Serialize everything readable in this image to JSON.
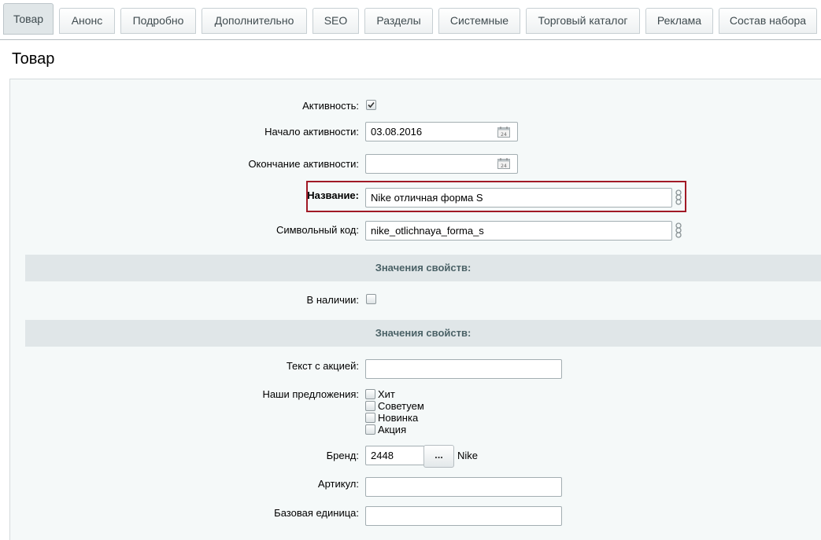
{
  "tabs": [
    "Товар",
    "Анонс",
    "Подробно",
    "Дополнительно",
    "SEO",
    "Разделы",
    "Системные",
    "Торговый каталог",
    "Реклама",
    "Состав набора"
  ],
  "page_title": "Товар",
  "fields": {
    "active": {
      "label": "Активность:",
      "checked": true
    },
    "start": {
      "label": "Начало активности:",
      "value": "03.08.2016"
    },
    "end": {
      "label": "Окончание активности:",
      "value": ""
    },
    "name": {
      "label": "Название:",
      "value": "Nike отличная форма S"
    },
    "code": {
      "label": "Символьный код:",
      "value": "nike_otlichnaya_forma_s"
    }
  },
  "section1": "Значения свойств:",
  "in_stock": {
    "label": "В наличии:",
    "checked": false
  },
  "section2": "Значения свойств:",
  "promo_text": {
    "label": "Текст с акцией:",
    "value": ""
  },
  "offers": {
    "label": "Наши предложения:",
    "options": [
      "Хит",
      "Советуем",
      "Новинка",
      "Акция"
    ]
  },
  "brand": {
    "label": "Бренд:",
    "value": "2448",
    "button": "...",
    "name": "Nike"
  },
  "article": {
    "label": "Артикул:",
    "value": ""
  },
  "base_unit": {
    "label": "Базовая единица:",
    "value": ""
  },
  "colors": {
    "highlight": "#a11a26",
    "section_bg": "#e0e6e8",
    "panel_bg": "#f5f9f9"
  }
}
